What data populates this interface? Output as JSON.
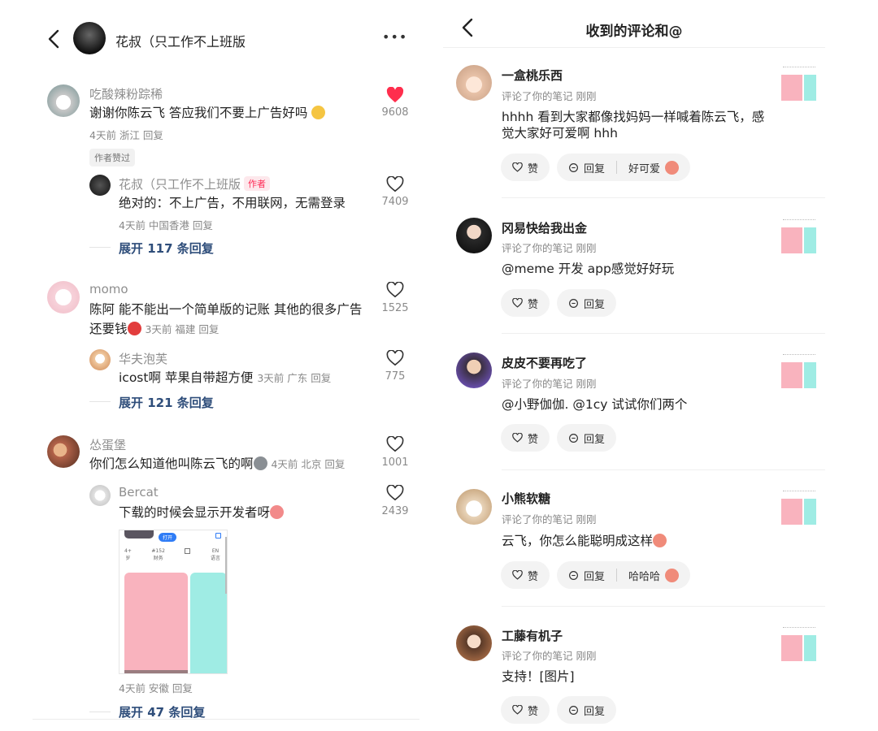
{
  "colors": {
    "accent_red": "#ff2e4d",
    "pink": "#f9b3be",
    "mint": "#9fece4",
    "link_blue": "#2e4d7a"
  },
  "left": {
    "header": {
      "title": "花叔（只工作不上班版",
      "more": "•••"
    },
    "comments": [
      {
        "user": "吃酸辣粉踪稀",
        "text": "谢谢你陈云飞 答应我们不要上广告好吗",
        "meta": "4天前 浙江 回复",
        "likes": "9608",
        "liked": true,
        "badge": "作者赞过"
      },
      {
        "user": "momo",
        "text1": "陈阿 能不能出一个简单版的记账 其他的很多广告",
        "text2": "还要钱",
        "meta": "3天前 福建 回复",
        "likes": "1525"
      },
      {
        "user": "怂蛋堡",
        "text": "你们怎么知道他叫陈云飞的啊",
        "meta": "4天前 北京 回复",
        "likes": "1001"
      }
    ],
    "replies": [
      {
        "user": "花叔（只工作不上班版",
        "tag": "作者",
        "text": "绝对的：不上广告，不用联网，无需登录",
        "meta": "4天前 中国香港 回复",
        "likes": "7409"
      },
      {
        "user": "华夫泡芙",
        "text": "icost啊 苹果自带超方便",
        "meta": "3天前 广东 回复",
        "likes": "775"
      },
      {
        "user": "Bercat",
        "text": "下载的时候会显示开发者呀",
        "meta": "4天前 安徽 回复",
        "likes": "2439"
      }
    ],
    "expand": [
      "展开 117 条回复",
      "展开 121 条回复",
      "展开 47 条回复"
    ],
    "screenshot": {
      "btn": "打开",
      "stats": [
        {
          "t": "4+",
          "b": "岁"
        },
        {
          "t": "#152",
          "b": "财务"
        },
        {
          "t": "",
          "b": ""
        },
        {
          "t": "EN",
          "b": "语言"
        }
      ]
    }
  },
  "right": {
    "header": {
      "title": "收到的评论和@"
    },
    "items": [
      {
        "name": "一盒桃乐西",
        "meta": "评论了你的笔记  刚刚",
        "text1": "hhhh 看到大家都像找妈妈一样喊着陈云飞，感",
        "text2": "觉大家好可爱啊 hhh",
        "quick": "好可爱"
      },
      {
        "name": "冈易快给我出金",
        "meta": "评论了你的笔记  刚刚",
        "text1": "@meme 开发 app感觉好好玩",
        "text2": "",
        "quick": ""
      },
      {
        "name": "皮皮不要再吃了",
        "meta": "评论了你的笔记  刚刚",
        "text1": "@小野伽伽. @1cy 试试你们两个",
        "text2": "",
        "quick": ""
      },
      {
        "name": "小熊软糖",
        "meta": "评论了你的笔记  刚刚",
        "text1": "云飞，你怎么能聪明成这样",
        "text2": "",
        "quick": "哈哈哈"
      },
      {
        "name": "工藤有机子",
        "meta": "评论了你的笔记  刚刚",
        "text1": "支持！[图片]",
        "text2": "",
        "quick": ""
      }
    ],
    "like_label": "赞",
    "reply_label": "回复"
  }
}
